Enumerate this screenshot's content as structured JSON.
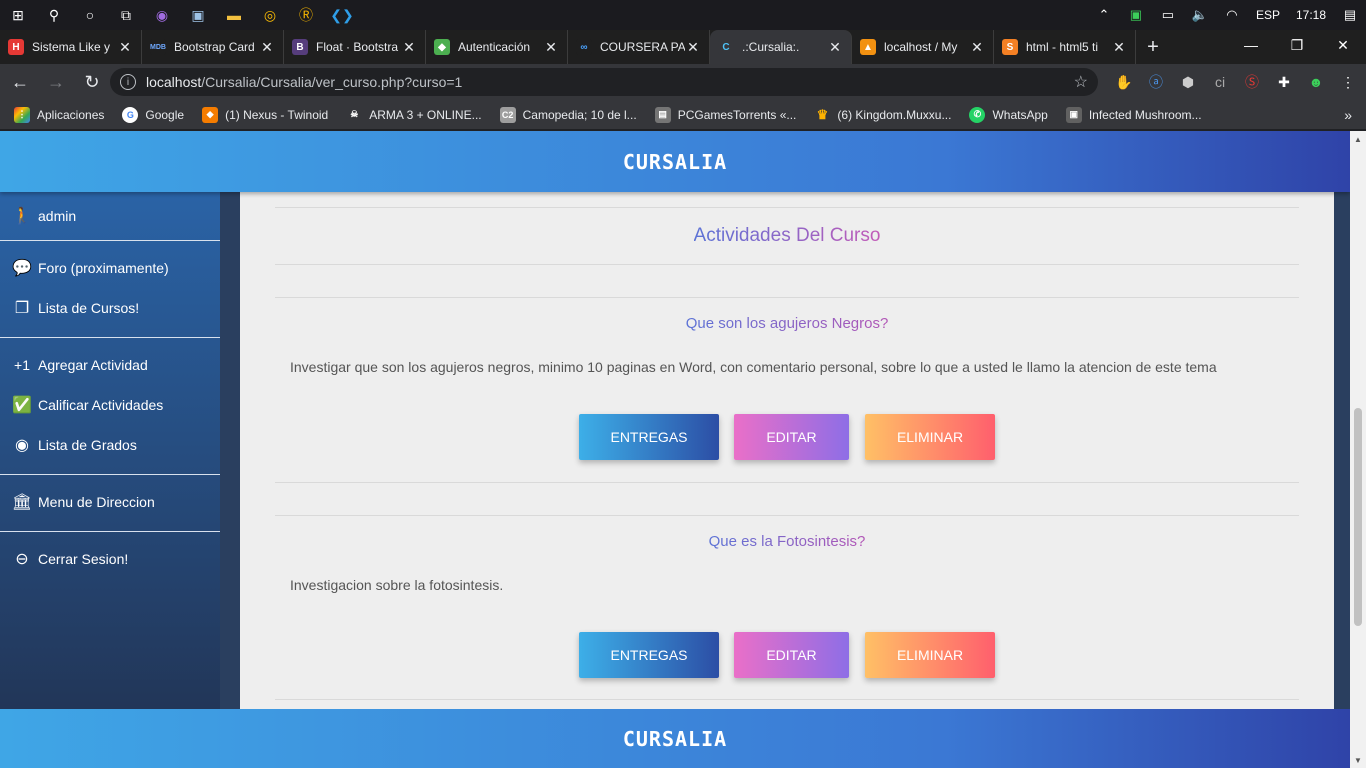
{
  "taskbar": {
    "language": "ESP",
    "time": "17:18"
  },
  "tabs": [
    {
      "title": "Sistema Like y",
      "favicon_color": "#e53935",
      "favicon_text": "H"
    },
    {
      "title": "Bootstrap Card",
      "favicon_color": "#1f1f1f",
      "favicon_text": "MDB"
    },
    {
      "title": "Float · Bootstra",
      "favicon_color": "#563d7c",
      "favicon_text": "B"
    },
    {
      "title": "Autenticación",
      "favicon_color": "#4caf50",
      "favicon_text": "◆"
    },
    {
      "title": "COURSERA PA",
      "favicon_color": "#1f1f1f",
      "favicon_text": "∞"
    },
    {
      "title": ".:Cursalia:.",
      "favicon_color": "#35363a",
      "favicon_text": "C"
    },
    {
      "title": "localhost / My",
      "favicon_color": "#f29111",
      "favicon_text": "▲"
    },
    {
      "title": "html - html5 ti",
      "favicon_color": "#f48024",
      "favicon_text": "S"
    }
  ],
  "toolbar": {
    "url_host": "localhost",
    "url_path": "/Cursalia/Cursalia/ver_curso.php?curso=1"
  },
  "bookmarks": [
    {
      "label": "Aplicaciones",
      "icon_color": "#e53935",
      "icon_text": "⋮"
    },
    {
      "label": "Google",
      "icon_color": "#4285f4",
      "icon_text": "G"
    },
    {
      "label": "(1) Nexus - Twinoid",
      "icon_color": "#f57c00",
      "icon_text": "◆"
    },
    {
      "label": "ARMA 3 + ONLINE...",
      "icon_color": "#35363a",
      "icon_text": "☠"
    },
    {
      "label": "Camopedia; 10 de l...",
      "icon_color": "#9e9e9e",
      "icon_text": "C2"
    },
    {
      "label": "PCGamesTorrents «...",
      "icon_color": "#757575",
      "icon_text": "▤"
    },
    {
      "label": "(6) Kingdom.Muxxu...",
      "icon_color": "#ffb300",
      "icon_text": "♛"
    },
    {
      "label": "WhatsApp",
      "icon_color": "#25d366",
      "icon_text": "✆"
    },
    {
      "label": "Infected Mushroom...",
      "icon_color": "#616161",
      "icon_text": "▣"
    }
  ],
  "site": {
    "logo": "CURSALIA"
  },
  "sidebar": {
    "user": "admin",
    "items": [
      {
        "label": "Foro (proximamente)",
        "icon": "chat-icon"
      },
      {
        "label": "Lista de Cursos!",
        "icon": "library-icon"
      },
      {
        "label": "Agregar Actividad",
        "icon": "plus-one-icon"
      },
      {
        "label": "Calificar Actividades",
        "icon": "clipboard-check-icon"
      },
      {
        "label": "Lista de Grados",
        "icon": "account-circle-icon"
      },
      {
        "label": "Menu de Direccion",
        "icon": "bank-icon"
      },
      {
        "label": "Cerrar Sesion!",
        "icon": "minus-circle-icon"
      }
    ]
  },
  "main": {
    "section_title": "Actividades Del Curso",
    "activities": [
      {
        "title": "Que son los agujeros Negros?",
        "description": "Investigar que son los agujeros negros, minimo 10 paginas en Word, con comentario personal, sobre lo que a usted le llamo la atencion de este tema"
      },
      {
        "title": "Que es la Fotosintesis?",
        "description": "Investigacion sobre la fotosintesis."
      }
    ],
    "buttons": {
      "entregas": "ENTREGAS",
      "editar": "EDITAR",
      "eliminar": "ELIMINAR"
    }
  }
}
